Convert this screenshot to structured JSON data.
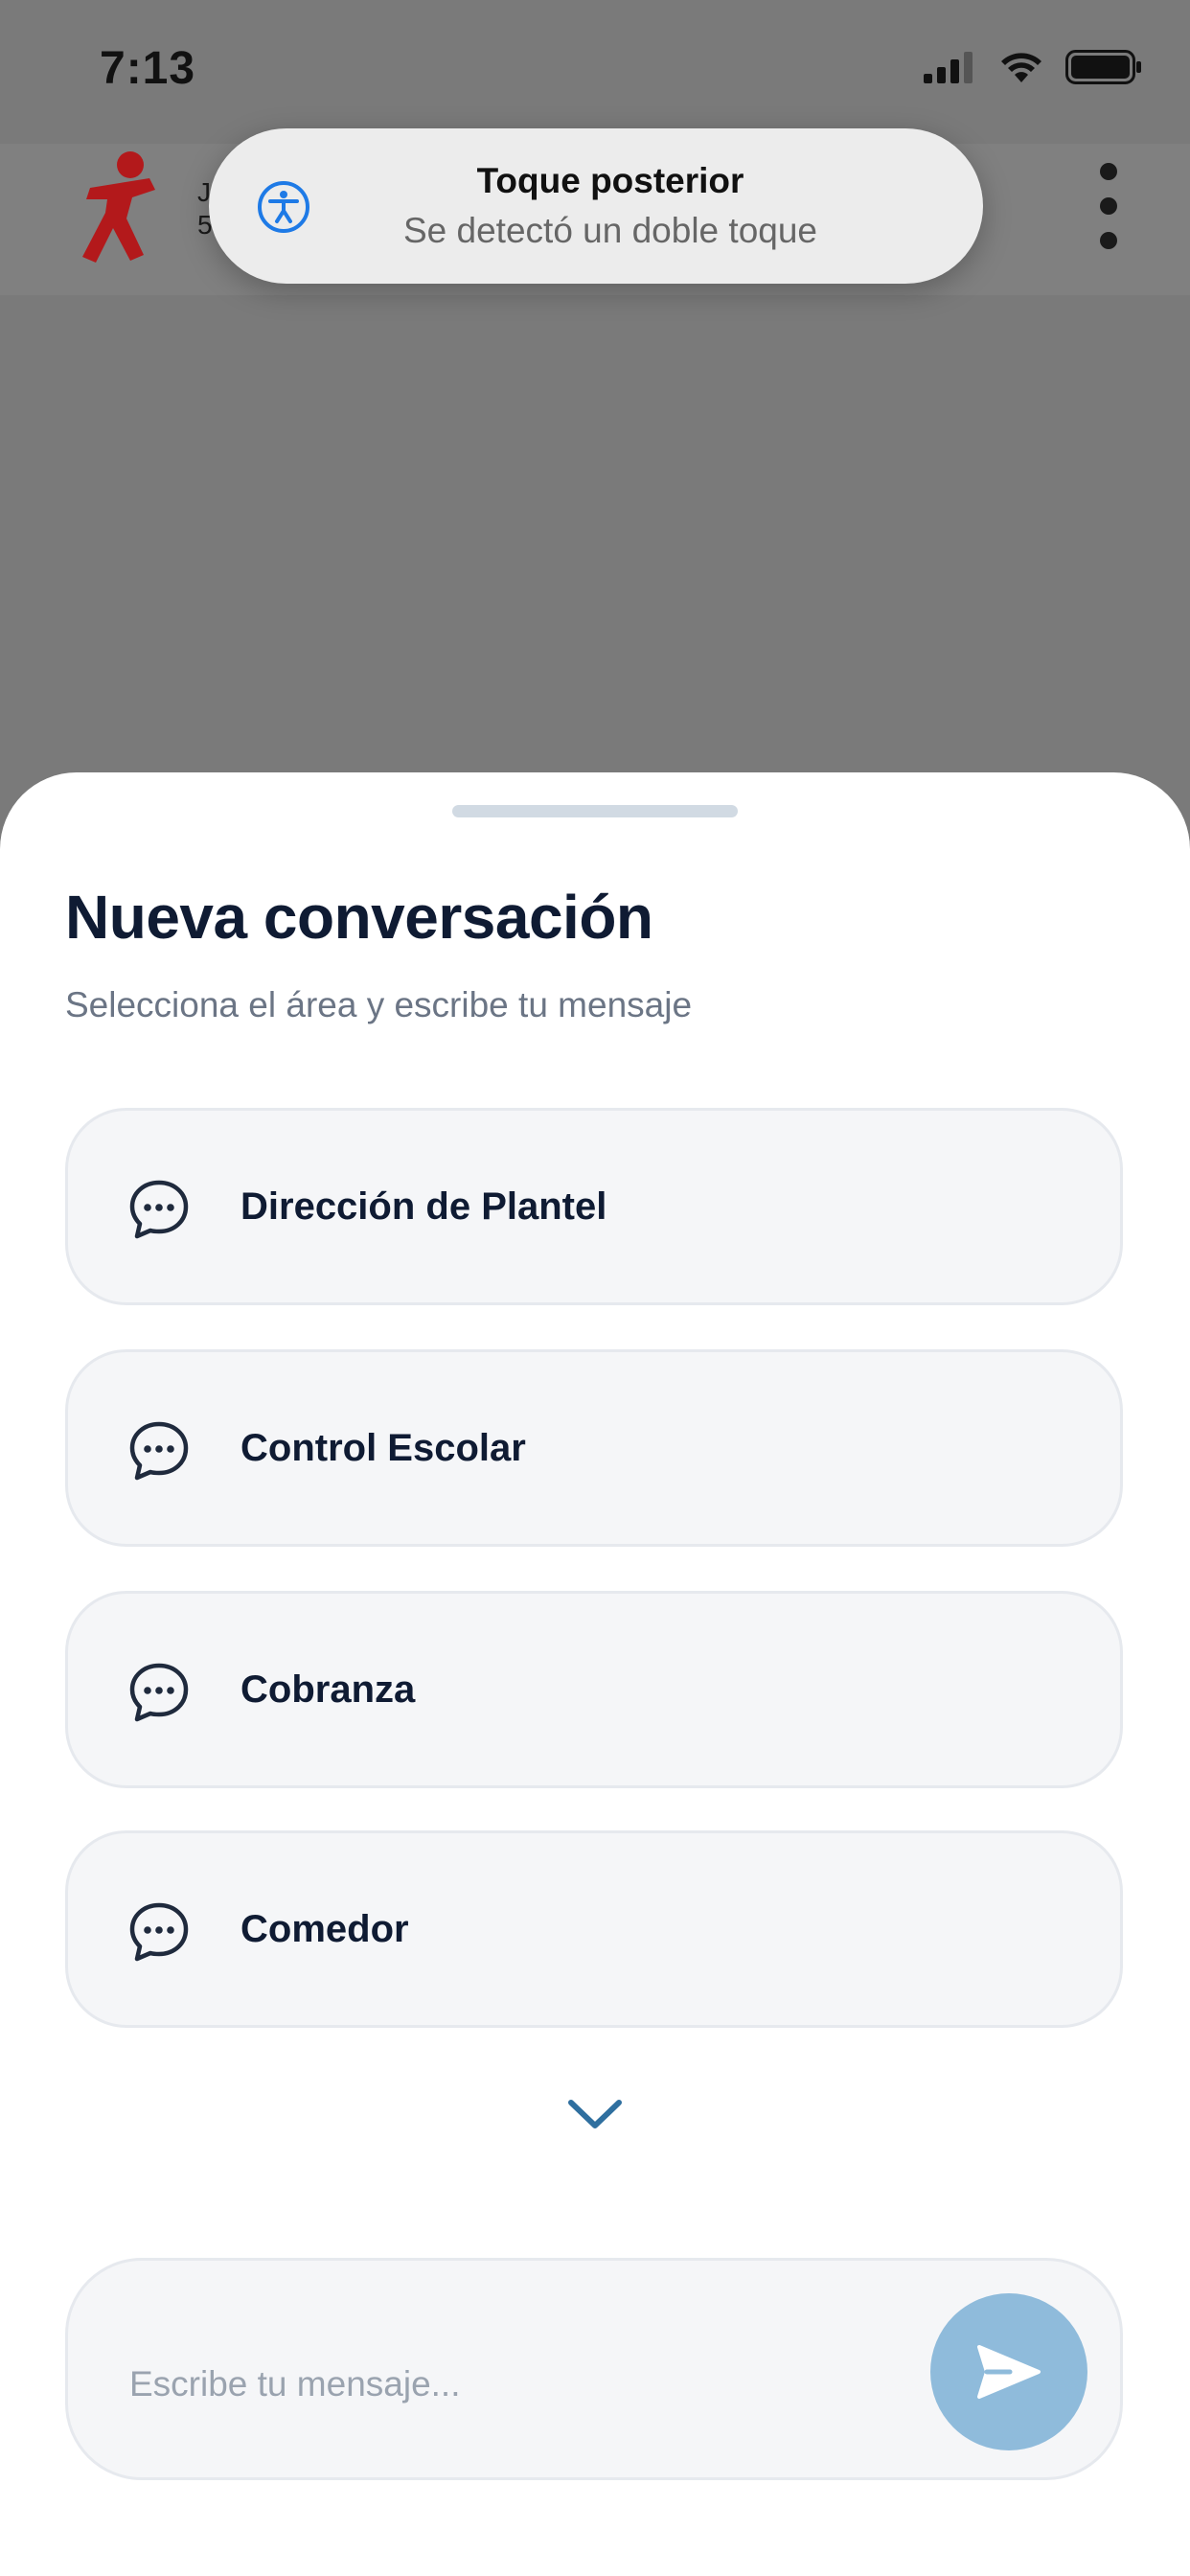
{
  "status_bar": {
    "time": "7:13"
  },
  "app_header": {
    "partial_text_1": "J",
    "partial_text_2": "5"
  },
  "toast": {
    "title": "Toque posterior",
    "subtitle": "Se detectó un doble toque"
  },
  "sheet": {
    "title": "Nueva conversación",
    "subtitle": "Selecciona el área y escribe tu mensaje",
    "options": [
      {
        "label": "Dirección de Plantel",
        "icon": "chat-bubble-icon"
      },
      {
        "label": "Control Escolar",
        "icon": "chat-bubble-icon"
      },
      {
        "label": "Cobranza",
        "icon": "chat-bubble-icon"
      },
      {
        "label": "Comedor",
        "icon": "chat-bubble-icon"
      }
    ],
    "composer": {
      "placeholder": "Escribe tu mensaje..."
    }
  },
  "colors": {
    "accent": "#8fbbdb",
    "title": "#0f1b33",
    "logo_red": "#b3191b",
    "chevron": "#2f6f9f"
  }
}
